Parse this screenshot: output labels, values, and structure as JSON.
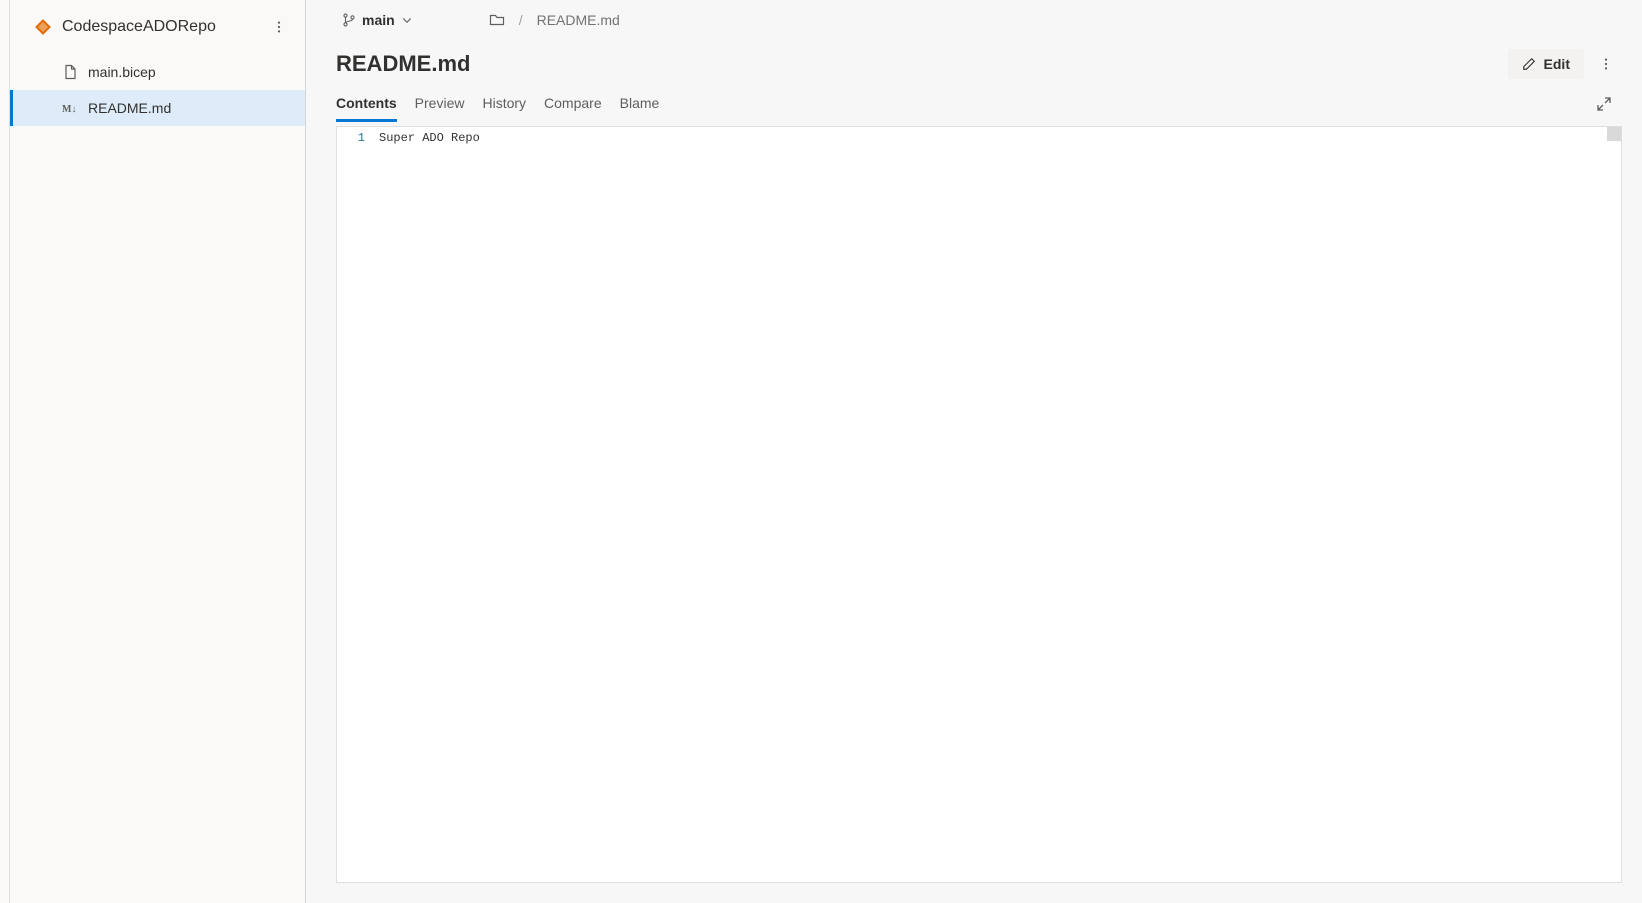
{
  "repo": {
    "name": "CodespaceADORepo",
    "icon": "repo-icon"
  },
  "files": [
    {
      "name": "main.bicep",
      "icon": "file-icon",
      "selected": false
    },
    {
      "name": "README.md",
      "icon": "markdown-icon",
      "selected": true
    }
  ],
  "branch": {
    "name": "main"
  },
  "breadcrumb": {
    "root_icon": "folder-icon",
    "separator": "/",
    "file": "README.md"
  },
  "file_header": {
    "title": "README.md",
    "edit_label": "Edit"
  },
  "tabs": [
    {
      "label": "Contents",
      "active": true
    },
    {
      "label": "Preview",
      "active": false
    },
    {
      "label": "History",
      "active": false
    },
    {
      "label": "Compare",
      "active": false
    },
    {
      "label": "Blame",
      "active": false
    }
  ],
  "editor": {
    "lines": [
      {
        "num": "1",
        "text": "Super ADO Repo"
      }
    ]
  }
}
